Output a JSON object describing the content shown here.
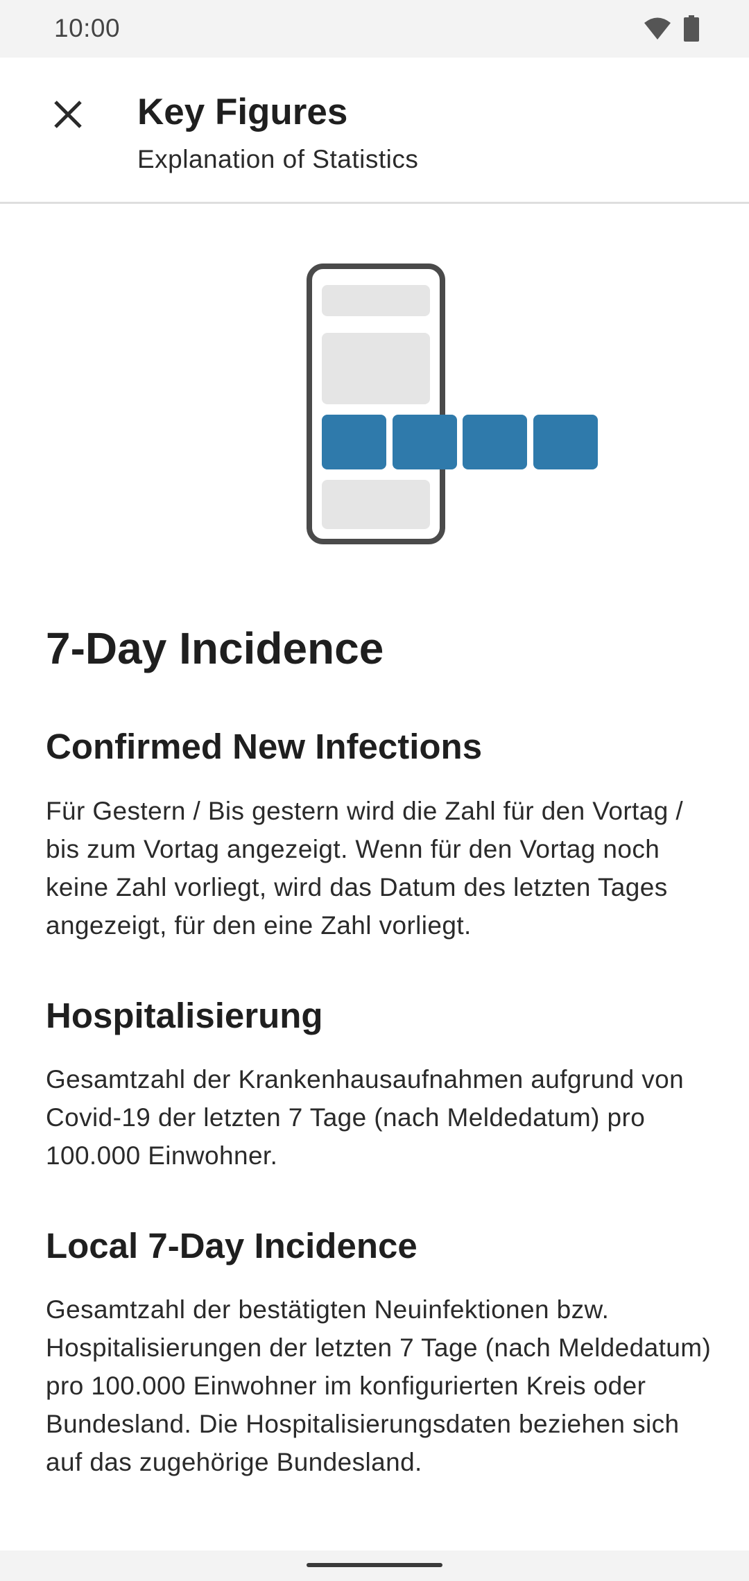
{
  "status_bar": {
    "time": "10:00",
    "icons": [
      "wifi-icon",
      "battery-icon"
    ]
  },
  "app_bar": {
    "title": "Key Figures",
    "subtitle": "Explanation of Statistics",
    "close_icon": "close-icon"
  },
  "colors": {
    "accent": "#2f7aab",
    "placeholder": "#e5e5e5",
    "phone_frame": "#4a4a4a"
  },
  "content": {
    "section_title": "7-Day Incidence",
    "sections": [
      {
        "heading": "Confirmed New Infections",
        "body": "Für Gestern / Bis gestern wird die Zahl für den Vortag / bis zum Vortag angezeigt. Wenn für den Vortag noch keine Zahl vorliegt, wird das Datum des letzten Tages angezeigt, für den eine Zahl vorliegt."
      },
      {
        "heading": "Hospitalisierung",
        "body": "Gesamtzahl der Krankenhausaufnahmen aufgrund von Covid-19 der letzten 7 Tage (nach Meldedatum) pro 100.000 Einwohner."
      },
      {
        "heading": "Local 7-Day Incidence",
        "body": "Gesamtzahl der bestätigten Neuinfektionen bzw. Hospitalisierungen der letzten 7 Tage (nach Meldedatum) pro 100.000 Einwohner im konfigurierten Kreis oder Bundesland. Die Hospitalisierungsdaten beziehen sich auf das zugehörige Bundesland."
      }
    ]
  }
}
